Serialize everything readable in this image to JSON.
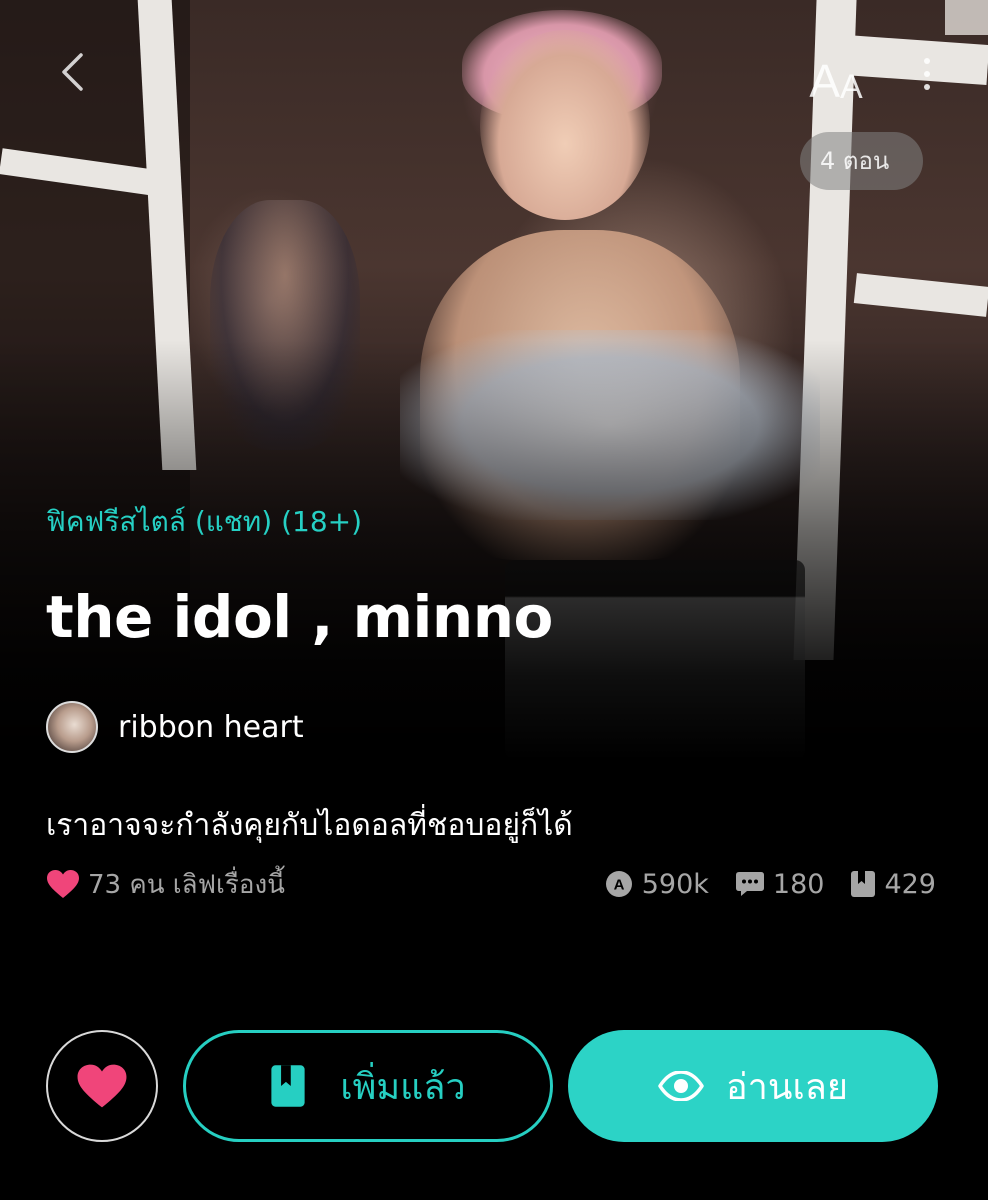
{
  "header": {
    "back_icon": "chevron-left-icon",
    "font_size_label_big": "A",
    "font_size_label_small": "A",
    "more_icon": "more-vertical-icon",
    "episodes_label": "4 ตอน"
  },
  "story": {
    "category": "ฟิคฟรีสไตล์ (แชท) (18+)",
    "title": "the idol , minno",
    "author": "ribbon heart",
    "description": "เราอาจจะกำลังคุยกับไอดอลที่ชอบอยู่ก็ได้"
  },
  "meta": {
    "love_text": "73 คน เลิฟเรื่องนี้",
    "views": "590k",
    "comments": "180",
    "bookmarks": "429"
  },
  "actions": {
    "added_label": "เพิ่มแล้ว",
    "read_label": "อ่านเลย"
  },
  "colors": {
    "accent": "#2cd3c6",
    "heart": "#f0457a",
    "muted_text": "#a6a6a6",
    "background": "#000000"
  }
}
